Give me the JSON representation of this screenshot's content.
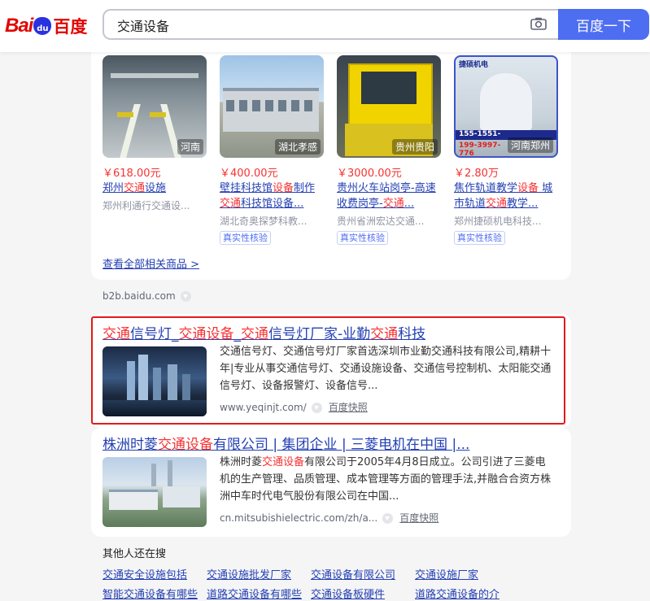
{
  "header": {
    "logo_text": "Bai",
    "logo_du": "du",
    "logo_cn": "百度",
    "query": "交通设备",
    "search_button": "百度一下"
  },
  "products": [
    {
      "location": "河南",
      "price": "￥618.00元",
      "title_pre": "郑州",
      "title_hl": "交通",
      "title_post": "设施",
      "title_line2": "",
      "seller": "郑州利通行交通设..."
    },
    {
      "location": "湖北孝感",
      "price": "￥400.00元",
      "title_pre": "壁挂科技馆",
      "title_hl": "设备",
      "title_post": "制作",
      "title_line2_hl": "交通",
      "title_line2": "科技馆设备...",
      "seller": "湖北奇奥探梦科教...",
      "verify": "真实性核验"
    },
    {
      "location": "贵州贵阳",
      "price": "￥3000.00元",
      "title_pre": "贵州火车站岗亭-高速",
      "title_line2": "收费岗亭-",
      "title_line2_hl": "交通",
      "title_line2_post": "...",
      "seller": "贵州省洲宏达交通...",
      "verify": "真实性核验"
    },
    {
      "location": "河南郑州",
      "price": "￥2.80万",
      "title_pre": "焦作轨道教学",
      "title_hl": "设备",
      "title_post": " 城",
      "title_line2": "市轨道",
      "title_line2_hl": "交通",
      "title_line2_post": "教学...",
      "seller": "郑州捷硕机电科技...",
      "verify": "真实性核验",
      "overlay_top": "捷硕机电",
      "overlay_phone": "155-1551-",
      "overlay_phone2": "199-3997-776"
    }
  ],
  "see_all": "查看全部相关商品 >",
  "source": "b2b.baidu.com",
  "result1": {
    "title": [
      "交通",
      "信号灯_",
      "交通设备",
      "_",
      "交通",
      "信号灯厂家-业勤",
      "交通",
      "科技"
    ],
    "abstract": "交通信号灯、交通信号灯厂家首选深圳市业勤交通科技有限公司,精耕十年|专业从事交通信号灯、交通设施设备、交通信号控制机、太阳能交通信号灯、设备报警灯、设备信号...",
    "url": "www.yeqinjt.com/",
    "snapshot": "百度快照"
  },
  "result2": {
    "title_pre": "株洲时菱",
    "title_hl": "交通设备",
    "title_post": "有限公司 | 集团企业 | 三菱电机在中国 |...",
    "abs_pre": "株洲时菱",
    "abs_hl": "交通设备",
    "abs_post": "有限公司于2005年4月8日成立。公司引进了三菱电机的生产管理、品质管理、成本管理等方面的管理手法,并融合合资方株洲中车时代电气股份有限公司在中国...",
    "url": "cn.mitsubishielectric.com/zh/a...",
    "snapshot": "百度快照"
  },
  "others_title": "其他人还在搜",
  "related": [
    "交通安全设施包括",
    "交通设施批发厂家",
    "交通设备有限公司",
    "交通设施厂家"
  ],
  "related2": [
    "智能交通设备有哪些",
    "道路交通设备有哪些",
    "交通设备板硬件",
    "道路交通设备的介"
  ]
}
